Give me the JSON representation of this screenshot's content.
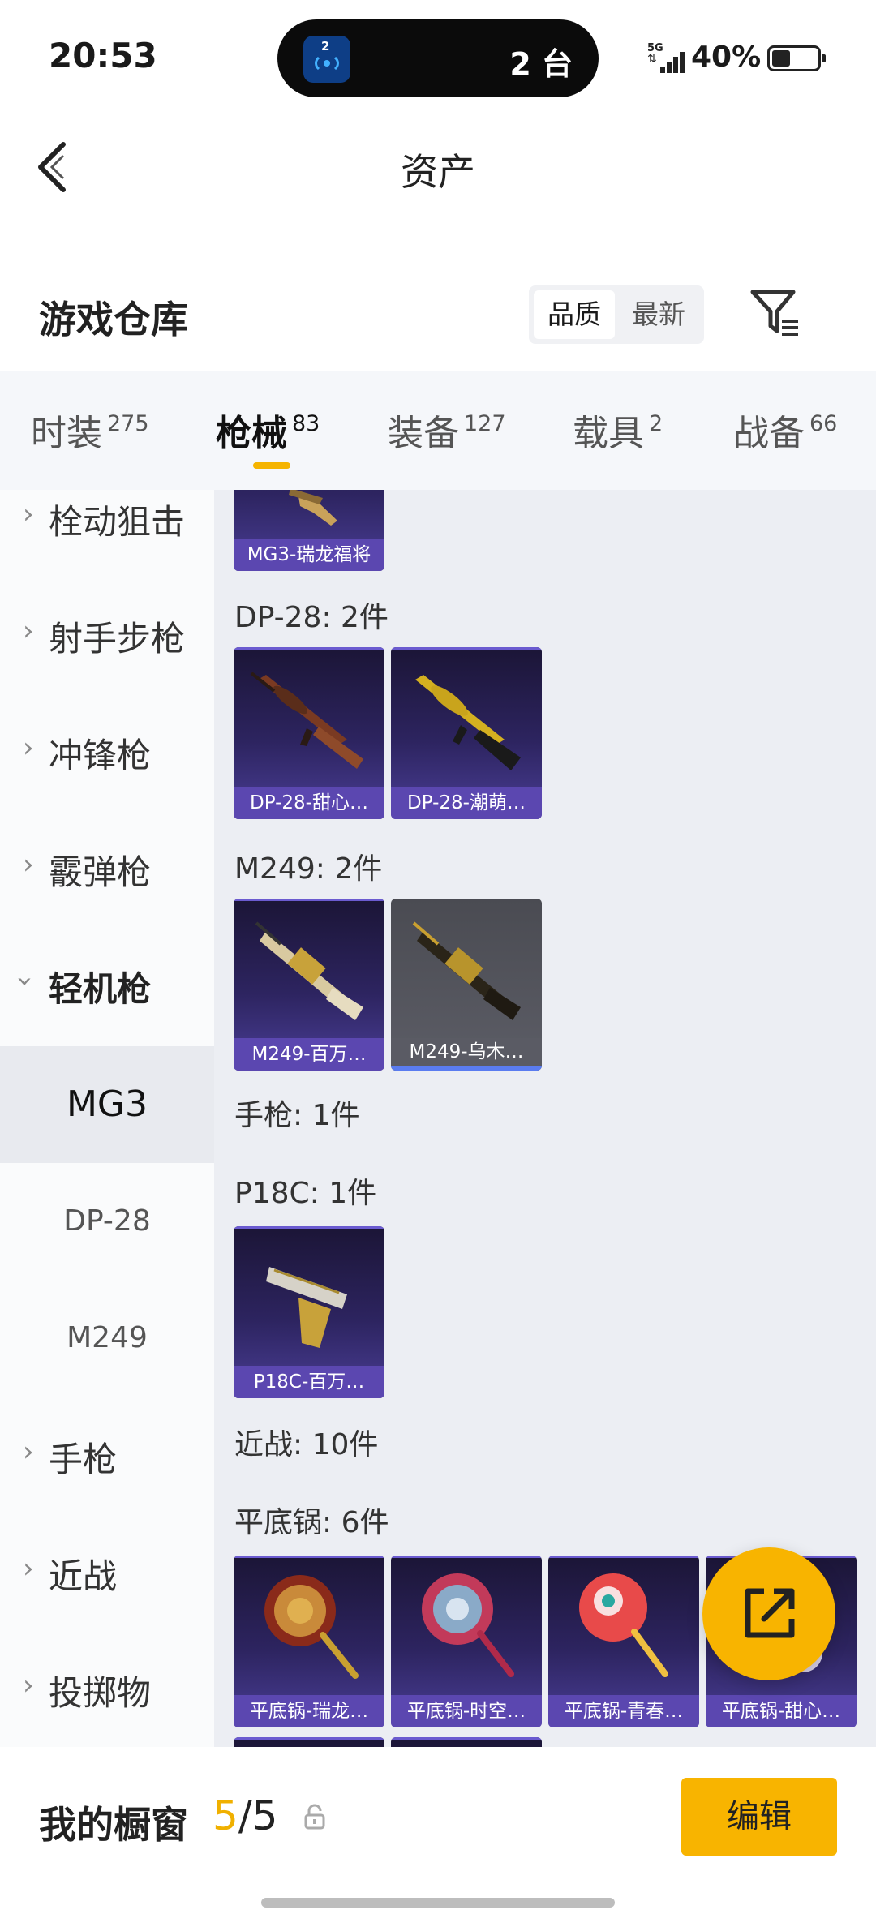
{
  "status_bar": {
    "time": "20:53",
    "island_badge": "2",
    "island_text": "2 台",
    "network": "5G",
    "battery": "40%"
  },
  "header": {
    "title": "资产",
    "back_icon": "chevron-left-icon"
  },
  "warehouse": {
    "title": "游戏仓库",
    "sort_options": [
      "品质",
      "最新"
    ],
    "sort_selected": "品质",
    "filter_icon": "filter-funnel-icon"
  },
  "tabs": [
    {
      "label": "时装",
      "count": "275"
    },
    {
      "label": "枪械",
      "count": "83",
      "active": true
    },
    {
      "label": "装备",
      "count": "127"
    },
    {
      "label": "载具",
      "count": "2"
    },
    {
      "label": "战备",
      "count": "66"
    }
  ],
  "accent_color": "#f8b400",
  "sidebar": {
    "items": [
      {
        "label": "栓动狙击"
      },
      {
        "label": "射手步枪"
      },
      {
        "label": "冲锋枪"
      },
      {
        "label": "霰弹枪"
      },
      {
        "label": "轻机枪",
        "expanded": true
      },
      {
        "label": "手枪"
      },
      {
        "label": "近战"
      },
      {
        "label": "投掷物"
      }
    ],
    "subitems": [
      {
        "label": "MG3",
        "active": true
      },
      {
        "label": "DP-28"
      },
      {
        "label": "M249"
      }
    ]
  },
  "content": {
    "groups": {
      "mg3_partial": {
        "cards": [
          "MG3-瑞龙福将"
        ]
      },
      "dp28": {
        "title": "DP-28: 2件",
        "cards": [
          "DP-28-甜心…",
          "DP-28-潮萌…"
        ]
      },
      "m249": {
        "title": "M249: 2件",
        "cards": [
          "M249-百万…",
          "M249-乌木…"
        ]
      },
      "pistol": {
        "title": "手枪: 1件"
      },
      "p18c": {
        "title": "P18C: 1件",
        "cards": [
          "P18C-百万…"
        ]
      },
      "melee": {
        "title": "近战: 10件"
      },
      "pan": {
        "title": "平底锅: 6件",
        "cards": [
          "平底锅-瑞龙…",
          "平底锅-时空…",
          "平底锅-青春…",
          "平底锅-甜心…"
        ]
      }
    }
  },
  "fab": {
    "icon": "share-export-icon"
  },
  "showcase": {
    "title": "我的橱窗",
    "current": "5",
    "separator": "/",
    "total": "5",
    "lock_icon": "lock-icon",
    "edit_label": "编辑"
  }
}
